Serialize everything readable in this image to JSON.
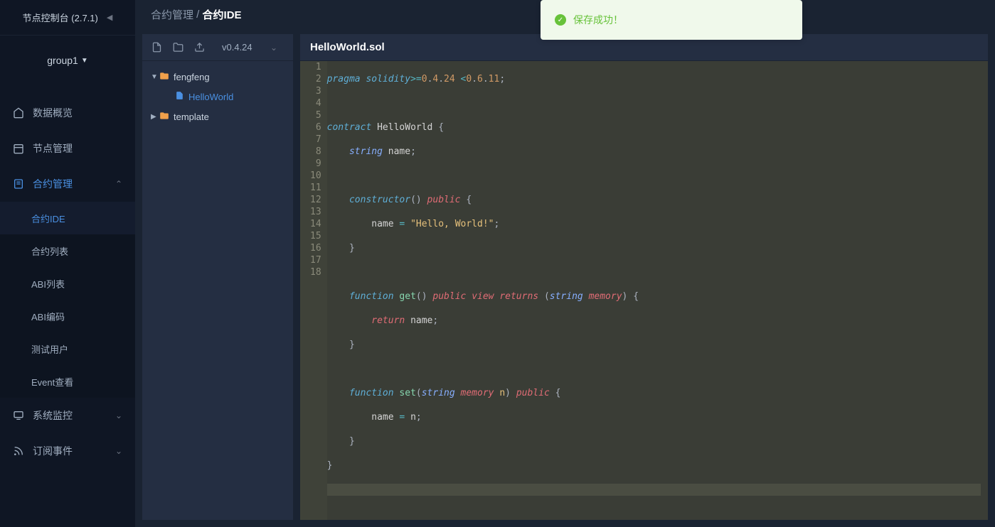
{
  "sidebar": {
    "title": "节点控制台 (2.7.1)",
    "group": "group1",
    "nav": {
      "data_overview": "数据概览",
      "node_mgmt": "节点管理",
      "contract_mgmt": "合约管理",
      "contract_sub": {
        "ide": "合约IDE",
        "list": "合约列表",
        "abi_list": "ABI列表",
        "abi_encode": "ABI编码",
        "test_user": "测试用户",
        "event_view": "Event查看"
      },
      "system_monitor": "系统监控",
      "subscribe": "订阅事件"
    }
  },
  "breadcrumb": {
    "parent": "合约管理",
    "current": "合约IDE"
  },
  "toast": {
    "message": "保存成功！"
  },
  "file_panel": {
    "version": "v0.4.24",
    "tree": {
      "folder1": "fengfeng",
      "file1": "HelloWorld",
      "folder2": "template"
    }
  },
  "editor": {
    "filename": "HelloWorld.sol",
    "lines": [
      1,
      2,
      3,
      4,
      5,
      6,
      7,
      8,
      9,
      10,
      11,
      12,
      13,
      14,
      15,
      16,
      17,
      18
    ]
  }
}
